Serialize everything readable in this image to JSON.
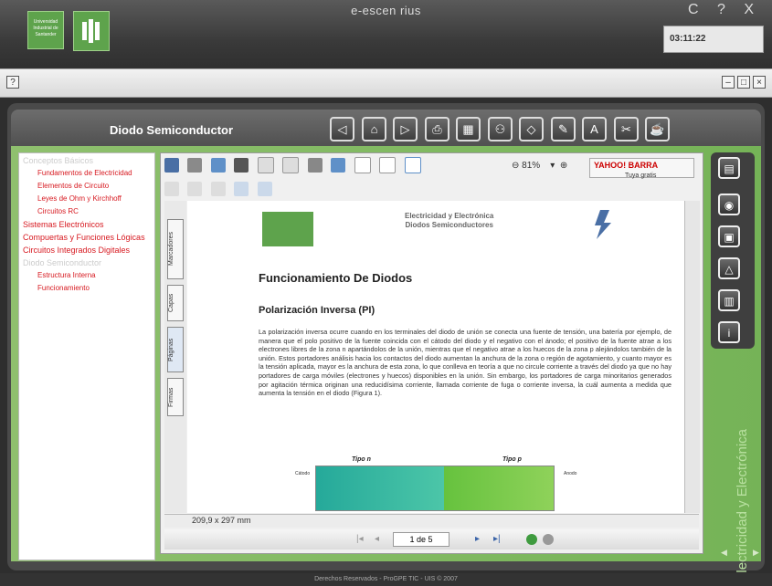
{
  "app": {
    "title": "e-escen  rius",
    "window_controls": "C ? X",
    "clock": "03:11:22",
    "logo_text": "Universidad Industrial de Santander"
  },
  "strip2": {
    "help_icon": "question-icon",
    "right_controls": [
      "minimize-icon",
      "restore-icon",
      "close-icon"
    ]
  },
  "content_title": "Diodo Semiconductor",
  "nav_buttons": [
    "back-icon",
    "home-icon",
    "forward-icon",
    "print-icon",
    "calculator-icon",
    "network-icon",
    "eraser-icon",
    "pencil-icon",
    "formula-icon",
    "tools-icon",
    "quiz-icon"
  ],
  "sidebar": {
    "items": [
      {
        "label": "Conceptos Básicos",
        "level": "head",
        "style": "muted"
      },
      {
        "label": "Fundamentos de Electricidad",
        "level": "sub"
      },
      {
        "label": "Elementos de Circuito",
        "level": "sub"
      },
      {
        "label": "Leyes de Ohm y Kirchhoff",
        "level": "sub"
      },
      {
        "label": "Circuitos RC",
        "level": "sub"
      },
      {
        "label": "Sistemas Electrónicos",
        "level": "head"
      },
      {
        "label": "Compuertas y Funciones Lógicas",
        "level": "head"
      },
      {
        "label": "Circuitos Integrados Digitales",
        "level": "head"
      },
      {
        "label": "Diodo Semiconductor",
        "level": "head",
        "style": "muted"
      },
      {
        "label": "Estructura Interna",
        "level": "sub"
      },
      {
        "label": "Funcionamiento",
        "level": "sub"
      }
    ]
  },
  "viewer": {
    "zoom": "81%",
    "yahoo_label": "YAHOO! BARRA",
    "yahoo_sub": "Tuya gratis",
    "page_size": "209,9 x 297 mm",
    "page_indicator": "1 de 5",
    "tabs": [
      "Marcadores",
      "Capas",
      "Páginas",
      "Firmas"
    ]
  },
  "page": {
    "header_line1": "Electricidad y Electrónica",
    "header_line2": "Diodos Semiconductores",
    "title": "Funcionamiento De Diodos",
    "subtitle": "Polarización Inversa (PI)",
    "body": "La polarización inversa ocurre cuando en los terminales del diodo de unión se conecta una fuente de tensión, una batería por ejemplo, de manera que el polo positivo de la fuente coincida con el cátodo del diodo y el negativo con el ánodo; el positivo de la fuente atrae a los electrones libres de la zona n apartándolos de la unión, mientras que el negativo atrae a los huecos de la zona p alejándolos también de la unión. Estos portadores análisis hacia los contactos del diodo aumentan la anchura de la zona o región de agotamiento, y cuanto mayor es la tensión aplicada, mayor es la anchura de esta zona, lo que conlleva en teoría a que no circule corriente a través del diodo ya que no hay portadores de carga móviles (electrones y huecos) disponibles en la unión. Sin embargo, los portadores de carga minoritarios generados por agitación térmica originan una reducidísima corriente, llamada corriente de fuga o corriente inversa, la cuál aumenta a medida que aumenta la tensión en el diodo (Figura 1).",
    "diagram": {
      "left_label": "Tipo n",
      "right_label": "Tipo p",
      "cathode": "Cátodo",
      "anode": "Anodo"
    }
  },
  "rail_text": "Electricidad y Electrónica",
  "footer": "Derechos Reservados - ProGPE TIC - UIS © 2007",
  "colors": {
    "accent": "#75b357",
    "link": "#d71920",
    "frame": "#4a4a4a"
  }
}
